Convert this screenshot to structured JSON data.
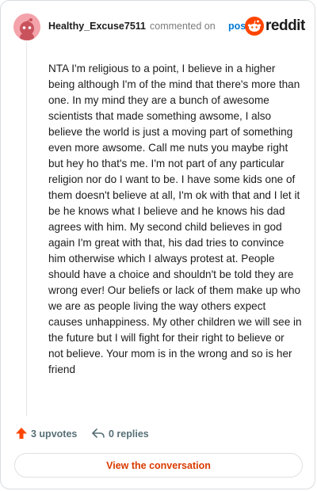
{
  "header": {
    "username": "Healthy_Excuse7511",
    "commented_on": "commented on",
    "post_link": "post",
    "brand_name": "reddit"
  },
  "comment": {
    "text": "NTA I'm religious to a point, I believe in a higher being although I'm of the mind that there's more than one. In my mind they are a bunch of awesome scientists that made something awsome, I also believe the world is just a moving part of something even more awsome. Call me nuts you maybe right but hey ho that's me. I'm not part of any particular religion nor do I want to be. I have some kids one of them doesn't believe at all, I'm ok with that and I let it be he knows what I believe and he knows his dad agrees with him. My second child believes in god again I'm great with that, his dad tries to convince him otherwise which I always protest at. People should have a choice and shouldn't be told they are wrong ever! Our beliefs or lack of them make up who we are as people living the way others expect causes unhappiness. My other children we will see in the future but I will fight for their right to believe or not believe. Your mom is in the wrong and so is her friend"
  },
  "actions": {
    "upvotes": "3 upvotes",
    "replies": "0 replies"
  },
  "footer": {
    "view_label": "View the conversation"
  },
  "icons": {
    "avatar": "snoo-avatar-icon",
    "brand": "reddit-logo-icon",
    "upvote": "upvote-arrow-icon",
    "reply": "reply-arrow-icon"
  },
  "colors": {
    "brand_orange": "#ff4500",
    "link_blue": "#0079d3",
    "button_text": "#d93a00",
    "meta_gray": "#576f76"
  }
}
